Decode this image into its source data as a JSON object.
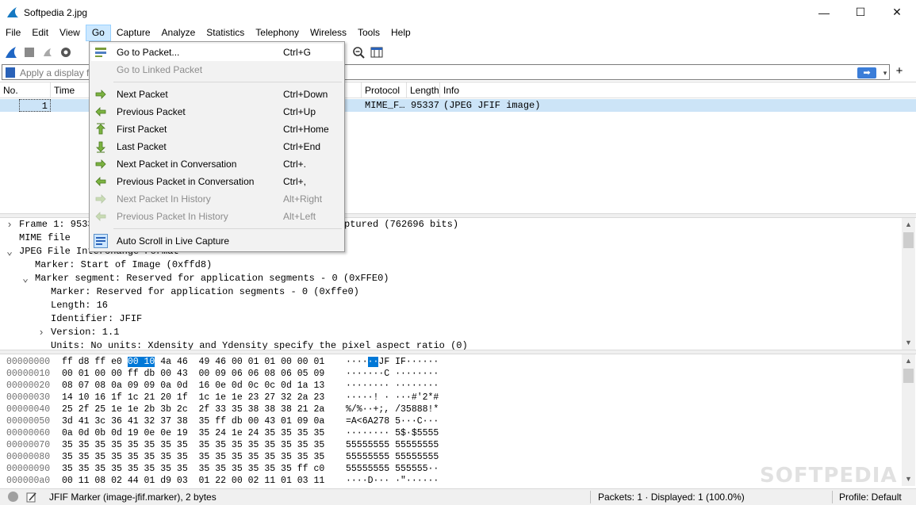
{
  "window": {
    "title": "Softpedia 2.jpg",
    "minimize": "—",
    "maximize": "☐",
    "close": "✕"
  },
  "menubar": [
    "File",
    "Edit",
    "View",
    "Go",
    "Capture",
    "Analyze",
    "Statistics",
    "Telephony",
    "Wireless",
    "Tools",
    "Help"
  ],
  "filter": {
    "placeholder": "Apply a display filt",
    "apply": "➡",
    "dropdown": "▾",
    "add": "+"
  },
  "packet_list": {
    "columns": [
      "No.",
      "Time",
      "Protocol",
      "Length",
      "Info"
    ],
    "row": {
      "no": "1",
      "protocol": "MIME_F…",
      "length": "95337",
      "info": "(JPEG JFIF image)"
    }
  },
  "go_menu": [
    {
      "label": "Go to Packet...",
      "shortcut": "Ctrl+G",
      "icon": "goto-packet-icon",
      "disabled": false,
      "hover": true
    },
    {
      "label": "Go to Linked Packet",
      "shortcut": "",
      "icon": "",
      "disabled": true
    },
    {
      "label": "Next Packet",
      "shortcut": "Ctrl+Down",
      "icon": "arrow-right-icon",
      "disabled": false
    },
    {
      "label": "Previous Packet",
      "shortcut": "Ctrl+Up",
      "icon": "arrow-left-icon",
      "disabled": false
    },
    {
      "label": "First Packet",
      "shortcut": "Ctrl+Home",
      "icon": "arrow-up-icon",
      "disabled": false
    },
    {
      "label": "Last Packet",
      "shortcut": "Ctrl+End",
      "icon": "arrow-down-icon",
      "disabled": false
    },
    {
      "label": "Next Packet in Conversation",
      "shortcut": "Ctrl+.",
      "icon": "arrow-right-icon",
      "disabled": false
    },
    {
      "label": "Previous Packet in Conversation",
      "shortcut": "Ctrl+,",
      "icon": "arrow-left-icon",
      "disabled": false
    },
    {
      "label": "Next Packet In History",
      "shortcut": "Alt+Right",
      "icon": "arrow-right-icon",
      "disabled": true
    },
    {
      "label": "Previous Packet In History",
      "shortcut": "Alt+Left",
      "icon": "arrow-left-icon",
      "disabled": true
    },
    {
      "label": "Auto Scroll in Live Capture",
      "shortcut": "",
      "icon": "auto-scroll-icon",
      "disabled": false
    }
  ],
  "details": [
    {
      "text": "Frame 1: 9533",
      "tail": "ptured (762696 bits)",
      "arrow": ">",
      "indent": 0
    },
    {
      "text": "MIME file",
      "arrow": "",
      "indent": 0
    },
    {
      "text": "JPEG File Interchange Format",
      "arrow": "v",
      "indent": 0
    },
    {
      "text": "Marker: Start of Image (0xffd8)",
      "arrow": "",
      "indent": 1
    },
    {
      "text": "Marker segment: Reserved for application segments - 0 (0xFFE0)",
      "arrow": "v",
      "indent": 1
    },
    {
      "text": "Marker: Reserved for application segments - 0 (0xffe0)",
      "arrow": "",
      "indent": 2
    },
    {
      "text": "Length: 16",
      "arrow": "",
      "indent": 2
    },
    {
      "text": "Identifier: JFIF",
      "arrow": "",
      "indent": 2
    },
    {
      "text": "Version: 1.1",
      "arrow": ">",
      "indent": 2
    },
    {
      "text": "Units: No units: Xdensity and Ydensity specify the pixel aspect ratio (0)",
      "arrow": "",
      "indent": 2
    }
  ],
  "bytes": [
    {
      "off": "00000000",
      "hexA": "ff d8 ff e0 ",
      "hexSel": "00 10",
      "hexB": " 4a 46  49 46 00 01 01 00 00 01",
      "ascA": "····",
      "ascSel": "··",
      "ascB": "JF IF······"
    },
    {
      "off": "00000010",
      "hex": "00 01 00 00 ff db 00 43  00 09 06 06 08 06 05 09",
      "asc": "·······C ········"
    },
    {
      "off": "00000020",
      "hex": "08 07 08 0a 09 09 0a 0d  16 0e 0d 0c 0c 0d 1a 13",
      "asc": "········ ········"
    },
    {
      "off": "00000030",
      "hex": "14 10 16 1f 1c 21 20 1f  1c 1e 1e 23 27 32 2a 23",
      "asc": "·····! · ···#'2*#"
    },
    {
      "off": "00000040",
      "hex": "25 2f 25 1e 1e 2b 3b 2c  2f 33 35 38 38 38 21 2a",
      "asc": "%/%··+;, /35888!*"
    },
    {
      "off": "00000050",
      "hex": "3d 41 3c 36 41 32 37 38  35 ff db 00 43 01 09 0a",
      "asc": "=A<6A278 5···C···"
    },
    {
      "off": "00000060",
      "hex": "0a 0d 0b 0d 19 0e 0e 19  35 24 1e 24 35 35 35 35",
      "asc": "········ 5$·$5555"
    },
    {
      "off": "00000070",
      "hex": "35 35 35 35 35 35 35 35  35 35 35 35 35 35 35 35",
      "asc": "55555555 55555555"
    },
    {
      "off": "00000080",
      "hex": "35 35 35 35 35 35 35 35  35 35 35 35 35 35 35 35",
      "asc": "55555555 55555555"
    },
    {
      "off": "00000090",
      "hex": "35 35 35 35 35 35 35 35  35 35 35 35 35 35 ff c0",
      "asc": "55555555 555555··"
    },
    {
      "off": "000000a0",
      "hex": "00 11 08 02 44 01 d9 03  01 22 00 02 11 01 03 11",
      "asc": "····D··· ·\"······"
    }
  ],
  "status": {
    "field": "JFIF Marker (image-jfif.marker), 2 bytes",
    "packets": "Packets: 1 · Displayed: 1 (100.0%)",
    "profile": "Profile: Default"
  },
  "watermark": "SOFTPEDIA",
  "colors": {
    "accent": "#0078d7",
    "selection": "#cce4f7",
    "menu_bg": "#f2f2f2"
  }
}
